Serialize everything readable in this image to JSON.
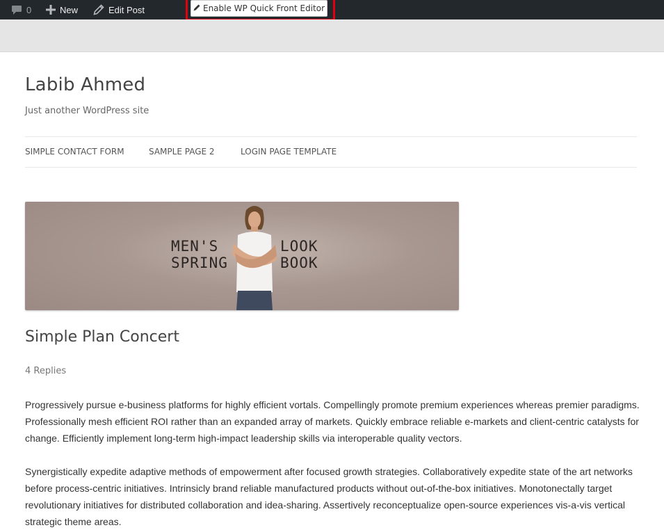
{
  "admin_bar": {
    "comments_count": "0",
    "new_label": "New",
    "edit_post_label": "Edit Post",
    "quick_editor_label": "Enable WP Quick Front Editor",
    "highlight_color": "#e00010",
    "bar_color": "#23282d"
  },
  "site": {
    "title": "Labib Ahmed",
    "description": "Just another WordPress site"
  },
  "nav": {
    "items": [
      {
        "label": "SIMPLE CONTACT FORM"
      },
      {
        "label": "SAMPLE PAGE 2"
      },
      {
        "label": "LOGIN PAGE TEMPLATE"
      }
    ]
  },
  "banner": {
    "left_text": "MEN'S\nSPRING",
    "right_text": "LOOK\nBOOK",
    "background_color": "#a89791"
  },
  "post": {
    "title": "Simple Plan Concert",
    "replies": "4 Replies",
    "paragraphs": [
      "Progressively pursue e-business platforms for highly efficient vortals. Compellingly promote premium experiences whereas premier paradigms. Professionally mesh efficient ROI rather than an expanded array of markets. Quickly embrace reliable e-markets and client-centric catalysts for change. Efficiently implement long-term high-impact leadership skills via interoperable quality vectors.",
      "Synergistically expedite adaptive methods of empowerment after focused growth strategies. Collaboratively expedite state of the art networks before process-centric initiatives. Intrinsicly brand reliable manufactured products without out-of-the-box initiatives. Monotonectally target revolutionary initiatives for distributed collaboration and idea-sharing. Assertively reconceptualize open-source experiences vis-a-vis vertical strategic theme areas."
    ]
  }
}
